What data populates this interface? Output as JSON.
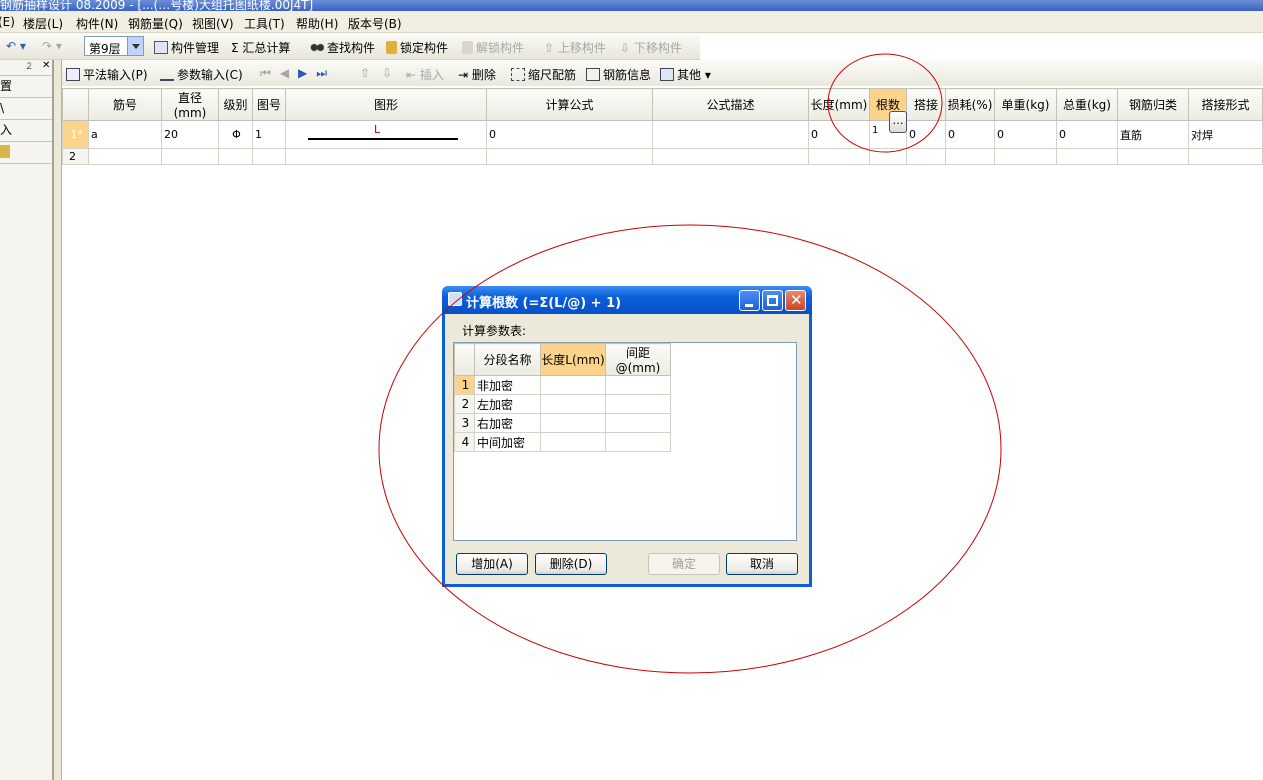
{
  "window": {
    "title_fragment": "钢筋抽样设计 08.2009 - [...(…号楼)大组托图纸楼.00J4T]"
  },
  "menu": [
    "(E)",
    "楼层(L)",
    "构件(N)",
    "钢筋量(Q)",
    "视图(V)",
    "工具(T)",
    "帮助(H)",
    "版本号(B)"
  ],
  "toolbar1": {
    "floor_combo": "第9层",
    "manage": "构件管理",
    "sum": "Σ 汇总计算",
    "find": "查找构件",
    "lock": "锁定构件",
    "unlock": "解锁构件",
    "move_up": "上移构件",
    "move_down": "下移构件"
  },
  "left_panel": {
    "items": [
      "置",
      "\\",
      "入",
      ""
    ]
  },
  "toolbar2": {
    "plain_input": "平法输入(P)",
    "param_input": "参数输入(C)",
    "insert": "插入",
    "delete": "删除",
    "scale": "缩尺配筋",
    "rebar_info": "钢筋信息",
    "other": "其他"
  },
  "grid": {
    "headers": [
      "",
      "筋号",
      "直径(mm)",
      "级别",
      "图号",
      "图形",
      "计算公式",
      "公式描述",
      "长度(mm)",
      "根数",
      "搭接",
      "损耗(%)",
      "单重(kg)",
      "总重(kg)",
      "钢筋归类",
      "搭接形式"
    ],
    "rows": [
      [
        "1*",
        "a",
        "20",
        "Φ",
        "1",
        "L",
        "0",
        "",
        "0",
        "1",
        "0",
        "0",
        "0",
        "0",
        "直筋",
        "对焊"
      ],
      [
        "2",
        "",
        "",
        "",
        "",
        "",
        "",
        "",
        "",
        "",
        "",
        "",
        "",
        "",
        "",
        ""
      ]
    ]
  },
  "dialog": {
    "title": "计算根数 (=Σ(L/@) + 1)",
    "param_label": "计算参数表:",
    "headers": [
      "",
      "分段名称",
      "长度L(mm)",
      "间距@(mm)"
    ],
    "rows": [
      [
        "1",
        "非加密"
      ],
      [
        "2",
        "左加密"
      ],
      [
        "3",
        "右加密"
      ],
      [
        "4",
        "中间加密"
      ]
    ],
    "buttons": {
      "add": "增加(A)",
      "delete": "删除(D)",
      "ok": "确定",
      "cancel": "取消"
    }
  },
  "colors": {
    "highlight_header": "#fcd38b",
    "dialog_border": "#0d5fd8",
    "annotation": "#cc0000"
  }
}
